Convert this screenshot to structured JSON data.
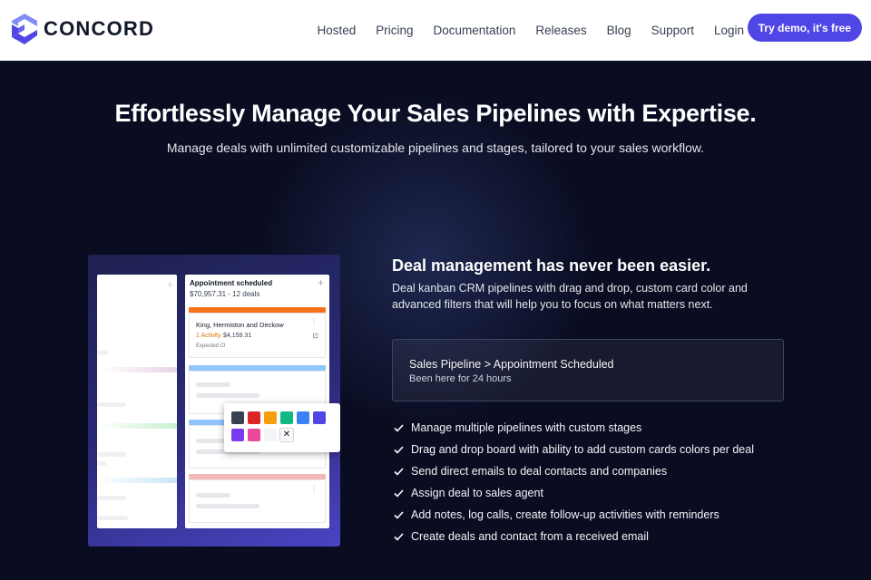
{
  "brand": {
    "name": "CONCORD",
    "accent": "#4f46e5"
  },
  "nav": {
    "items": [
      "Hosted",
      "Pricing",
      "Documentation",
      "Releases",
      "Blog",
      "Support",
      "Login"
    ],
    "cta": "Try demo, it's free"
  },
  "hero": {
    "title": "Effortlessly Manage Your Sales Pipelines with Expertise.",
    "subtitle": "Manage deals with unlimited customizable pipelines and stages, tailored to your sales workflow."
  },
  "board": {
    "column_title": "Appointment scheduled",
    "column_summary": "$70,957.31 - 12 deals",
    "card": {
      "title": "King, Hermiston and Deckow",
      "activity": "1 Activity",
      "amount": "$4,159.31",
      "expected": "Expected Cl"
    },
    "swatch_colors": [
      "#374151",
      "#dc2626",
      "#f59e0b",
      "#10b981",
      "#3b82f6",
      "#4f46e5",
      "#7c3aed",
      "#ec4899"
    ],
    "close_label": "✕"
  },
  "section": {
    "title": "Deal management has never been easier.",
    "body": "Deal kanban CRM pipelines with drag and drop, custom card color and advanced filters that will help you to focus on what matters next."
  },
  "pipeline": {
    "path": "Sales Pipeline > Appointment Scheduled",
    "status": "Been here for 24 hours"
  },
  "features": [
    "Manage multiple pipelines with custom stages",
    "Drag and drop board with ability to add custom cards colors per deal",
    "Send direct emails to deal contacts and companies",
    "Assign deal to sales agent",
    "Add notes, log calls, create follow-up activities with reminders",
    "Create deals and contact from a received email"
  ]
}
